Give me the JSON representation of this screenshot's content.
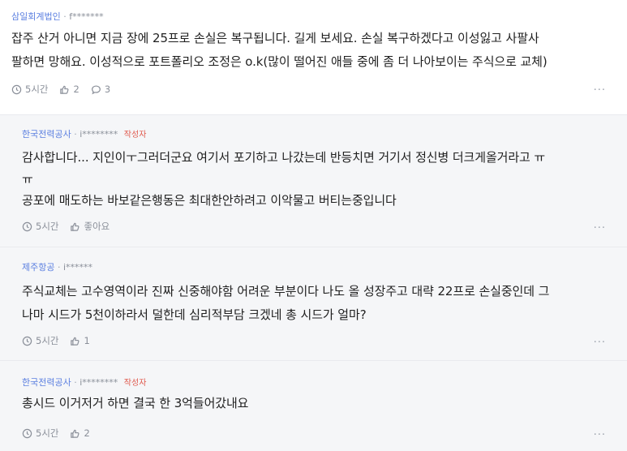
{
  "comments": [
    {
      "company": "삼일회계법인",
      "separator": "·",
      "handle": "f*******",
      "badge": "",
      "lines": [
        "잡주 산거 아니면 지금 장에 25프로 손실은 복구됩니다. 길게 보세요. 손실 복구하겠다고 이성잃고 사팔사",
        "팔하면 망해요. 이성적으로 포트폴리오 조정은 o.k(많이 떨어진 애들 중에 좀 더 나아보이는 주식으로 교체)"
      ],
      "time": "5시간",
      "likes": "2",
      "replies": "3",
      "more": "···"
    },
    {
      "company": "한국전력공사",
      "separator": "·",
      "handle": "i********",
      "badge": "작성자",
      "lines": [
        "감사합니다... 지인이ㅜ그러더군요 여기서 포기하고 나갔는데 반등치면 거기서 정신병 더크게올거라고 ㅠ",
        "ㅠ",
        "공포에 매도하는 바보같은행동은 최대한안하려고 이악물고 버티는중입니다"
      ],
      "time": "5시간",
      "likes": "좋아요",
      "more": "···"
    },
    {
      "company": "제주항공",
      "separator": "·",
      "handle": "i******",
      "badge": "",
      "lines": [
        "주식교체는 고수영역이라 진짜 신중해야함 어려운 부분이다 나도 올 성장주고 대략 22프로 손실중인데 그",
        "나마 시드가 5천이하라서 덜한데 심리적부담 크겠네 총 시드가 얼마?"
      ],
      "time": "5시간",
      "likes": "1",
      "more": "···"
    },
    {
      "company": "한국전력공사",
      "separator": "·",
      "handle": "i********",
      "badge": "작성자",
      "lines": [
        "총시드 이거저거 하면 결국 한 3억들어갔내요"
      ],
      "time": "5시간",
      "likes": "2",
      "more": "···"
    }
  ]
}
